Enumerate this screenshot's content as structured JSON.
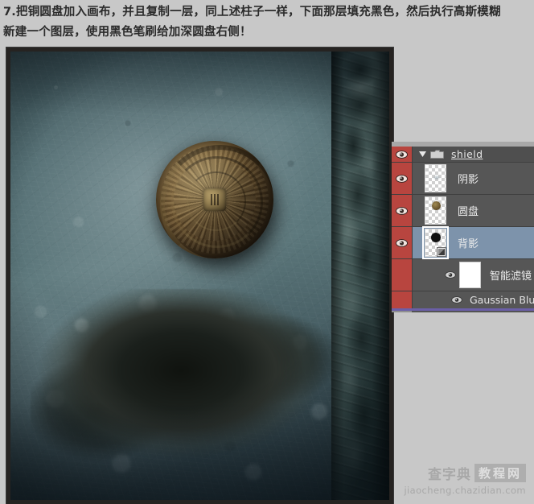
{
  "instruction": {
    "line1": "7.把铜圆盘加入画布，并且复制一层，同上述柱子一样，下面那层填充黑色，然后执行高斯模糊",
    "line2": "新建一个图层，使用黑色笔刷给加深圆盘右侧！"
  },
  "canvas": {
    "name": "document-canvas",
    "description": "weathered teal concrete wall with broken plaster, bronze ceremonial shield disc, carved stone dragon pillar at right"
  },
  "layers_panel": {
    "group": {
      "name": "shield",
      "visible": true,
      "expanded": true,
      "disclosure_icon": "chevron-down-icon",
      "folder_icon": "folder-icon"
    },
    "layers": [
      {
        "name": "阴影",
        "visible": true,
        "selected": false,
        "thumb": "transparent",
        "eye_icon": "eye-icon"
      },
      {
        "name": "圆盘",
        "visible": true,
        "selected": false,
        "thumb": "bronze-disc",
        "eye_icon": "eye-icon"
      },
      {
        "name": "背影",
        "visible": true,
        "selected": true,
        "thumb": "black-disc-smart-object",
        "eye_icon": "eye-icon"
      }
    ],
    "smart_filters": {
      "label": "智能滤镜",
      "visible": true,
      "mask_thumb": "white-mask",
      "eye_icon": "eye-icon",
      "entries": [
        {
          "label": "Gaussian Blur",
          "visible": true,
          "eye_icon": "eye-icon"
        }
      ]
    }
  },
  "watermark": {
    "brand": "查字典",
    "badge": "教程网",
    "url": "jiaocheng.chazidian.com"
  },
  "colors": {
    "page_background": "#c8c8c8",
    "panel_background": "#565656",
    "eye_column": "#b8453f",
    "selected_row": "#7d93ab",
    "text": "#ededed",
    "accent_line": "#6b5fa8"
  }
}
